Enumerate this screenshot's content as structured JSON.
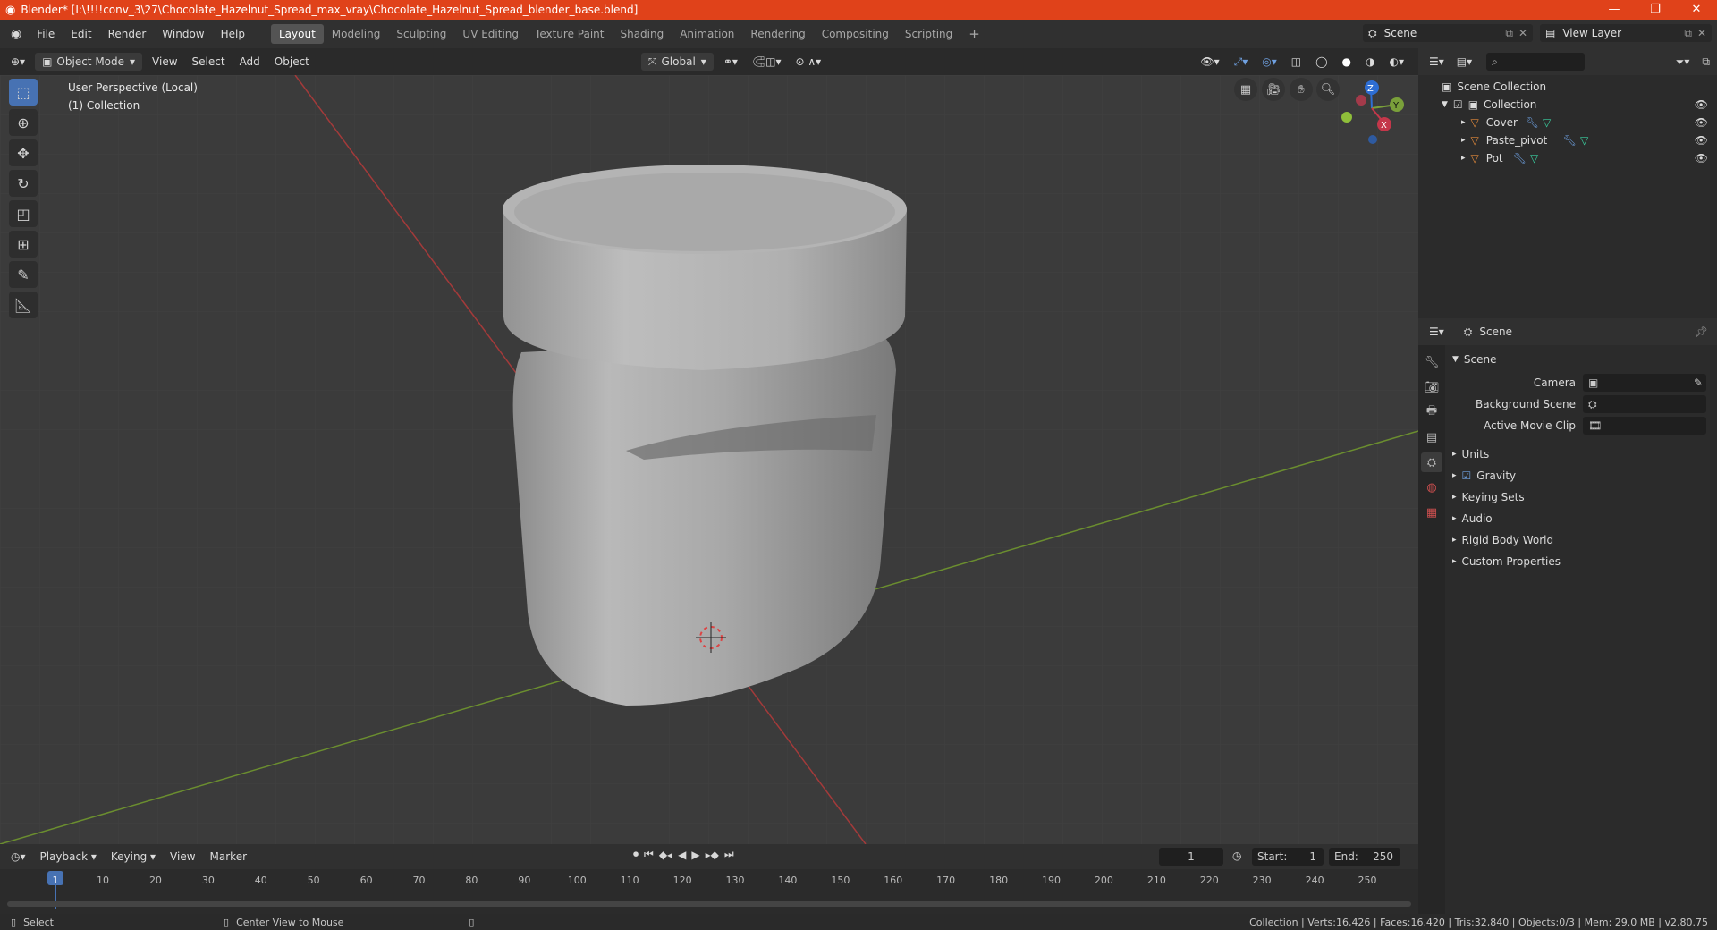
{
  "window": {
    "title": "Blender* [I:\\!!!!conv_3\\27\\Chocolate_Hazelnut_Spread_max_vray\\Chocolate_Hazelnut_Spread_blender_base.blend]",
    "minimize": "—",
    "restore": "❐",
    "close": "✕"
  },
  "menus": [
    "File",
    "Edit",
    "Render",
    "Window",
    "Help"
  ],
  "workspaces": [
    "Layout",
    "Modeling",
    "Sculpting",
    "UV Editing",
    "Texture Paint",
    "Shading",
    "Animation",
    "Rendering",
    "Compositing",
    "Scripting"
  ],
  "add_workspace": "+",
  "scene_selector": "Scene",
  "view_layer_selector": "View Layer",
  "viewport_header": {
    "mode": "Object Mode",
    "menus": [
      "View",
      "Select",
      "Add",
      "Object"
    ],
    "orientation": "Global"
  },
  "viewport": {
    "perspective_label": "User Perspective (Local)",
    "collection_label": "(1) Collection",
    "gizmo": {
      "z": "Z",
      "y": "Y",
      "x": "X"
    }
  },
  "outliner": {
    "root": "Scene Collection",
    "collection": "Collection",
    "objects": [
      "Cover",
      "Paste_pivot",
      "Pot"
    ]
  },
  "properties": {
    "header_title": "Scene",
    "panel_title": "Scene",
    "fields": {
      "camera_label": "Camera",
      "background_scene_label": "Background Scene",
      "active_movie_clip_label": "Active Movie Clip"
    },
    "sections": [
      "Units",
      "Gravity",
      "Keying Sets",
      "Audio",
      "Rigid Body World",
      "Custom Properties"
    ]
  },
  "timeline": {
    "menus": [
      "Playback",
      "Keying",
      "View",
      "Marker"
    ],
    "current_frame": "1",
    "start_label": "Start:",
    "start_value": "1",
    "end_label": "End:",
    "end_value": "250",
    "ticks": [
      "1",
      "10",
      "20",
      "30",
      "40",
      "50",
      "60",
      "70",
      "80",
      "90",
      "100",
      "110",
      "120",
      "130",
      "140",
      "150",
      "160",
      "170",
      "180",
      "190",
      "200",
      "210",
      "220",
      "230",
      "240",
      "250"
    ]
  },
  "statusbar": {
    "left_action": "Select",
    "middle_action": "Center View to Mouse",
    "stats": "Collection | Verts:16,426 | Faces:16,420 | Tris:32,840 | Objects:0/3 | Mem: 29.0 MB | v2.80.75"
  },
  "colors": {
    "titlebar": "#e0421a",
    "accent": "#4772b3",
    "x_axis": "#c4374a",
    "y_axis": "#7aa03a",
    "z_axis": "#2e6ed4",
    "current_frame": "#4772b3"
  }
}
